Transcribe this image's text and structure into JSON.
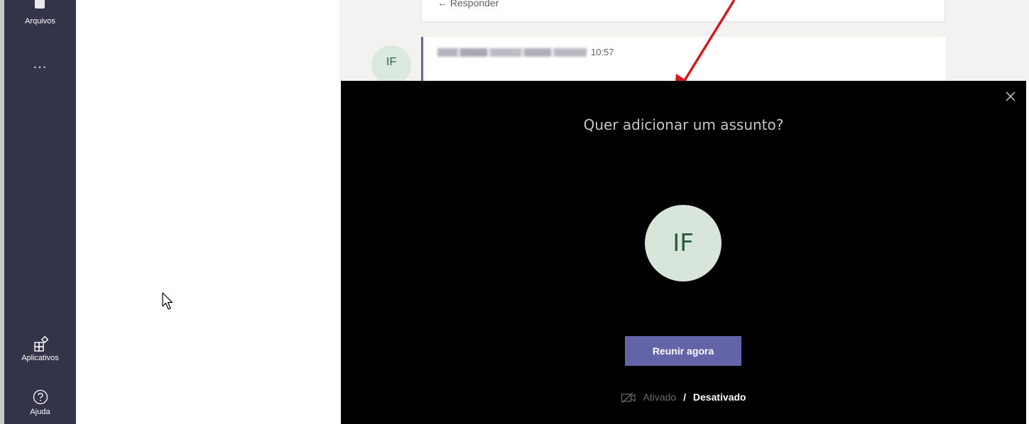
{
  "rail": {
    "files_label": "Arquivos",
    "more_label": "...",
    "apps_label": "Aplicativos",
    "help_label": "Ajuda"
  },
  "chat": {
    "reply_label": "Responder",
    "message_time": "10:57",
    "avatar_initials": "IF"
  },
  "meeting": {
    "title": "Quer adicionar um assunto?",
    "avatar_initials": "IF",
    "join_button": "Reunir agora",
    "video_on": "Ativado",
    "video_separator": "/",
    "video_off": "Desativado"
  },
  "colors": {
    "rail_bg": "#33344a",
    "accent": "#6264a7",
    "dialog_bg": "#000000",
    "annotation": "#d31b1b"
  },
  "icons": {
    "files": "files-icon",
    "apps": "apps-icon",
    "help": "help-icon",
    "close": "close-icon",
    "camera_off": "camera-off-icon"
  }
}
